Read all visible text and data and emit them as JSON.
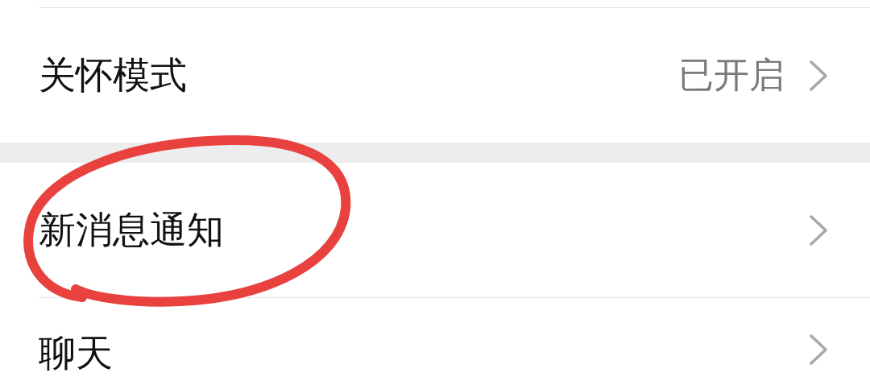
{
  "settings": [
    {
      "kind": "row",
      "label": "关怀模式",
      "value": "已开启",
      "circled": false
    },
    {
      "kind": "gap"
    },
    {
      "kind": "row",
      "label": "新消息通知",
      "circled": true
    },
    {
      "kind": "row",
      "label": "聊天",
      "circled": false
    }
  ]
}
